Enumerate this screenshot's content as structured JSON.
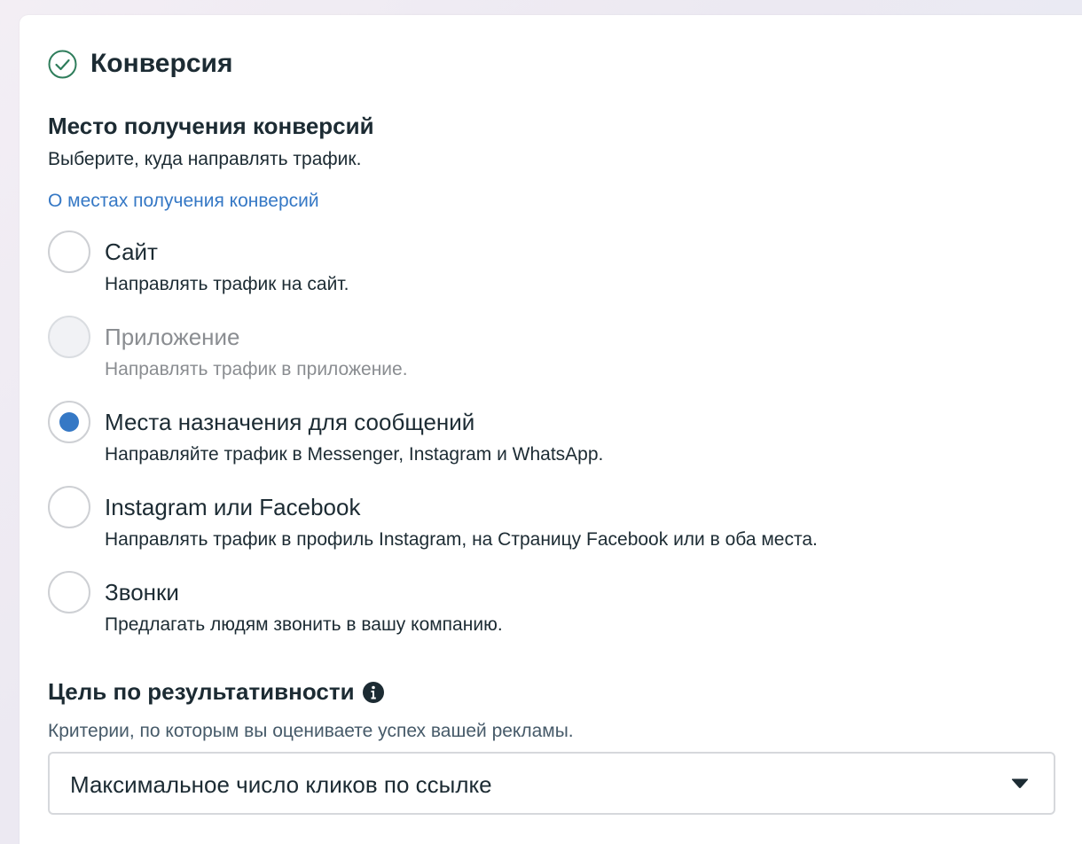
{
  "header": {
    "title": "Конверсия",
    "check_icon": "check-circle-icon",
    "accent": "#2e7d5b"
  },
  "conversion_location": {
    "title": "Место получения конверсий",
    "subtitle": "Выберите, куда направлять трафик.",
    "link": "О местах получения конверсий",
    "options": [
      {
        "label": "Сайт",
        "description": "Направлять трафик на сайт.",
        "state": "unselected"
      },
      {
        "label": "Приложение",
        "description": "Направлять трафик в приложение.",
        "state": "disabled"
      },
      {
        "label": "Места назначения для сообщений",
        "description": "Направляйте трафик в Messenger, Instagram и WhatsApp.",
        "state": "selected"
      },
      {
        "label": "Instagram или Facebook",
        "description": "Направлять трафик в профиль Instagram, на Страницу Facebook или в оба места.",
        "state": "unselected"
      },
      {
        "label": "Звонки",
        "description": "Предлагать людям звонить в вашу компанию.",
        "state": "unselected"
      }
    ]
  },
  "performance_goal": {
    "title": "Цель по результативности",
    "info_icon": "info-icon",
    "subtitle": "Критерии, по которым вы оцениваете успех вашей рекламы.",
    "selected_value": "Максимальное число кликов по ссылке",
    "dropdown_icon": "caret-down-icon"
  },
  "colors": {
    "link": "#3578c5",
    "radio_selected": "#3578c5",
    "text": "#1c2b33",
    "muted": "#8a8d91"
  }
}
